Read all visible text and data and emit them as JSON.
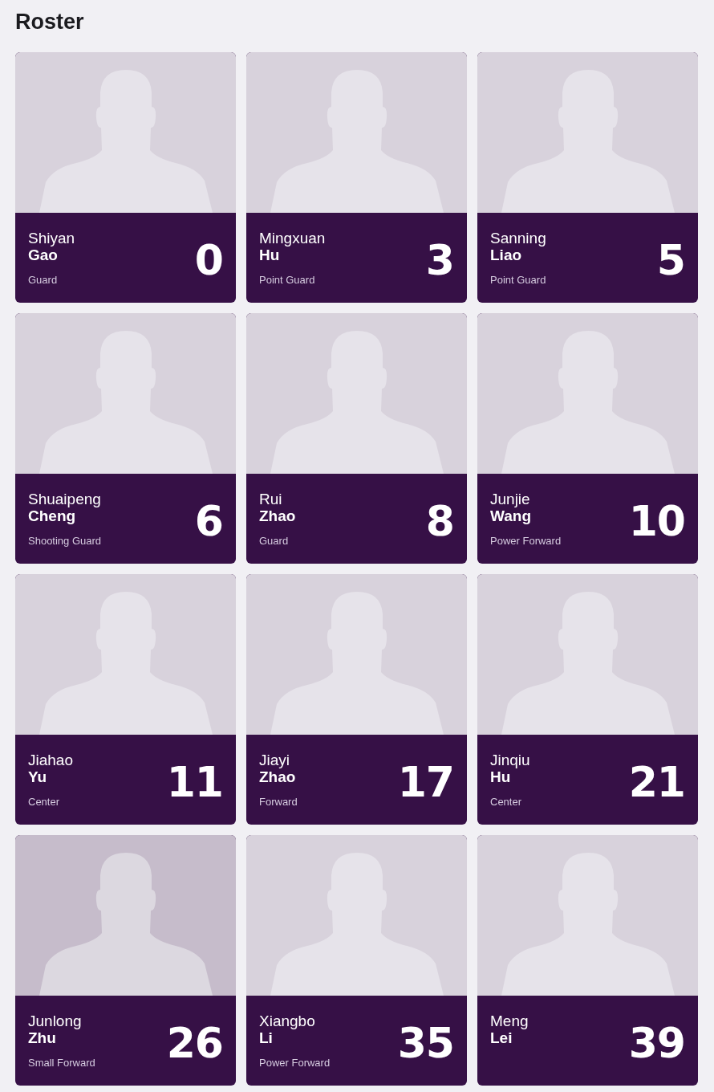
{
  "title": "Roster",
  "players": [
    {
      "first_name": "Shiyan",
      "last_name": "Gao",
      "position": "Guard",
      "number": "0",
      "highlighted": false
    },
    {
      "first_name": "Mingxuan",
      "last_name": "Hu",
      "position": "Point Guard",
      "number": "3",
      "highlighted": false
    },
    {
      "first_name": "Sanning",
      "last_name": "Liao",
      "position": "Point Guard",
      "number": "5",
      "highlighted": false
    },
    {
      "first_name": "Shuaipeng",
      "last_name": "Cheng",
      "position": "Shooting Guard",
      "number": "6",
      "highlighted": false
    },
    {
      "first_name": "Rui",
      "last_name": "Zhao",
      "position": "Guard",
      "number": "8",
      "highlighted": false
    },
    {
      "first_name": "Junjie",
      "last_name": "Wang",
      "position": "Power Forward",
      "number": "10",
      "highlighted": false
    },
    {
      "first_name": "Jiahao",
      "last_name": "Yu",
      "position": "Center",
      "number": "11",
      "highlighted": false
    },
    {
      "first_name": "Jiayi",
      "last_name": "Zhao",
      "position": "Forward",
      "number": "17",
      "highlighted": false
    },
    {
      "first_name": "Jinqiu",
      "last_name": "Hu",
      "position": "Center",
      "number": "21",
      "highlighted": false
    },
    {
      "first_name": "Junlong",
      "last_name": "Zhu",
      "position": "Small Forward",
      "number": "26",
      "highlighted": true
    },
    {
      "first_name": "Xiangbo",
      "last_name": "Li",
      "position": "Power Forward",
      "number": "35",
      "highlighted": false
    },
    {
      "first_name": "Meng",
      "last_name": "Lei",
      "number": "39",
      "highlighted": false
    }
  ]
}
